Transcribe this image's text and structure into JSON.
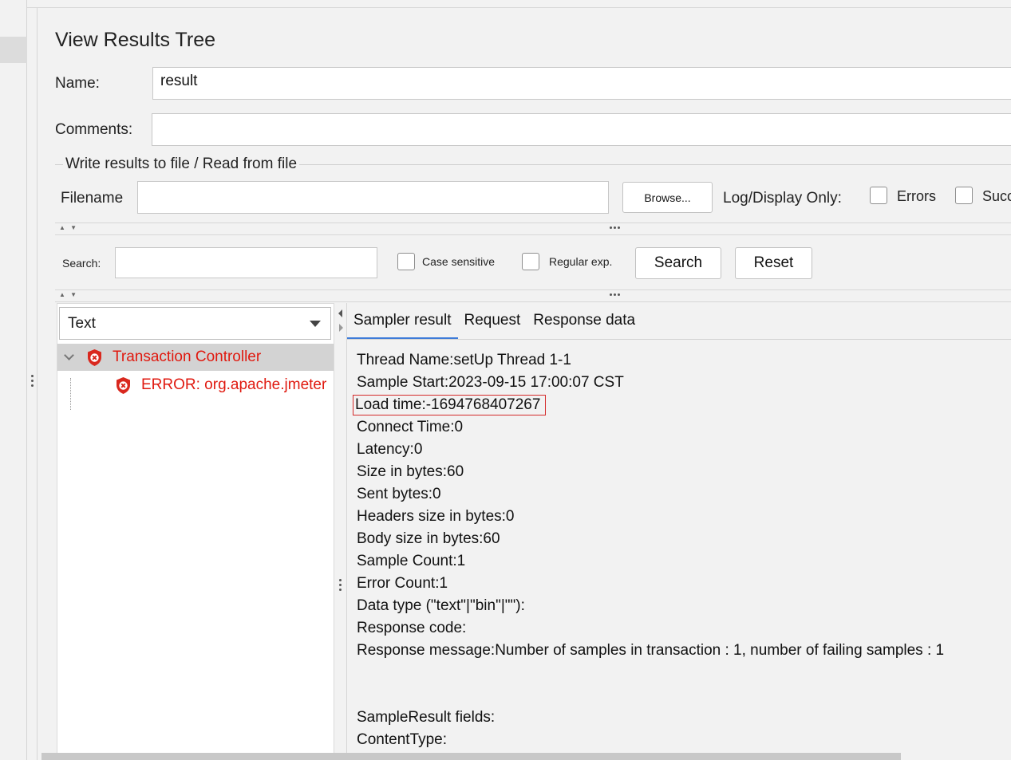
{
  "panel": {
    "title": "View Results Tree",
    "name_label": "Name:",
    "name_value": "result",
    "comments_label": "Comments:",
    "comments_value": ""
  },
  "file_group": {
    "title": "Write results to file / Read from file",
    "filename_label": "Filename",
    "filename_value": "",
    "browse_label": "Browse...",
    "log_display_label": "Log/Display Only:",
    "errors_label": "Errors",
    "successes_label": "Succ"
  },
  "search_bar": {
    "label": "Search:",
    "value": "",
    "case_sensitive_label": "Case sensitive",
    "regexp_label": "Regular exp.",
    "search_button": "Search",
    "reset_button": "Reset"
  },
  "renderer_select": {
    "selected": "Text"
  },
  "tree": {
    "items": [
      {
        "label": "Transaction Controller",
        "status": "error",
        "icon": "error-shield-icon"
      },
      {
        "label": "ERROR: org.apache.jmeter",
        "status": "error",
        "icon": "error-shield-icon"
      }
    ]
  },
  "tabs": [
    {
      "label": "Sampler result",
      "active": true
    },
    {
      "label": "Request",
      "active": false
    },
    {
      "label": "Response data",
      "active": false
    }
  ],
  "sampler_result": {
    "lines": [
      "Thread Name:setUp Thread 1-1",
      "Sample Start:2023-09-15 17:00:07 CST",
      "Load time:-1694768407267",
      "Connect Time:0",
      "Latency:0",
      "Size in bytes:60",
      "Sent bytes:0",
      "Headers size in bytes:0",
      "Body size in bytes:60",
      "Sample Count:1",
      "Error Count:1",
      "Data type (\"text\"|\"bin\"|\"\"):",
      "Response code:",
      "Response message:Number of samples in transaction : 1, number of failing samples : 1",
      "",
      "",
      "SampleResult fields:",
      "ContentType:"
    ]
  },
  "colors": {
    "error_text": "#e0190f",
    "highlight_box": "#d42a2a",
    "active_tab": "#3d7bd8"
  }
}
